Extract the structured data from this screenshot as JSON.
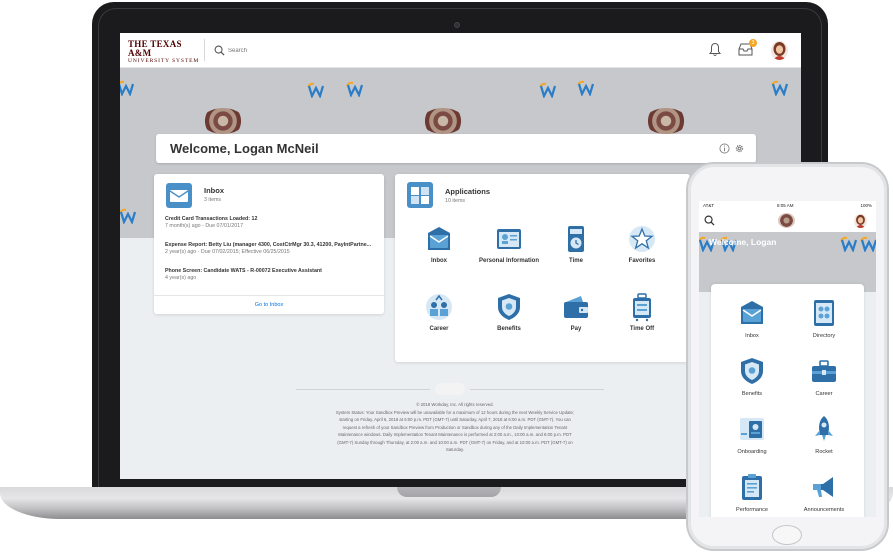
{
  "header": {
    "logo_line1": "THE TEXAS A&M",
    "logo_line2": "UNIVERSITY SYSTEM",
    "search_placeholder": "Search",
    "inbox_badge_count": "3"
  },
  "welcome": {
    "title": "Welcome, Logan McNeil"
  },
  "inbox": {
    "title": "Inbox",
    "count": "3 items",
    "items": [
      {
        "title": "Credit Card Transactions Loaded: 12",
        "sub": "7 month(s) ago - Due 07/01/2017"
      },
      {
        "title": "Expense Report: Betty Liu (manager 4300, CostCtrMgr 30.3, 41200, PayIntPartne...",
        "sub": "2 year(s) ago - Due 07/02/2015; Effective 06/25/2015"
      },
      {
        "title": "Phone Screen: Candidate WATS - R-00072 Executive Assistant",
        "sub": "4 year(s) ago"
      }
    ],
    "footer_link": "Go to Inbox"
  },
  "applications": {
    "title": "Applications",
    "count": "10 items",
    "apps": [
      {
        "label": "Inbox",
        "icon": "inbox-icon"
      },
      {
        "label": "Personal Information",
        "icon": "id-card-icon"
      },
      {
        "label": "Time",
        "icon": "clock-icon"
      },
      {
        "label": "Favorites",
        "icon": "star-icon"
      },
      {
        "label": "Career",
        "icon": "career-icon"
      },
      {
        "label": "Benefits",
        "icon": "shield-icon"
      },
      {
        "label": "Pay",
        "icon": "wallet-icon"
      },
      {
        "label": "Time Off",
        "icon": "suitcase-icon"
      }
    ]
  },
  "footer": {
    "brand": "workday",
    "lines": [
      "© 2018 Workday, Inc. All rights reserved.",
      "System Status: Your Sandbox Preview will be unavailable for a maximum of 12 hours during the next Weekly Service Update;",
      "starting on Friday, April 6, 2018 at 6:00 p.m. PDT (GMT-7) until Saturday, April 7, 2018 at 6:00 a.m. PDT (GMT-7). You can",
      "request a refresh of your Sandbox Preview from Production or Sandbox during any of the Daily Implementation Tenant",
      "Maintenance windows. Daily Implementation Tenant Maintenance is performed at 2:00 a.m., 10:00 a.m. and 6:00 p.m. PDT",
      "(GMT-7) Sunday through Thursday, at 2:00 a.m. and 10:00 a.m. PDT (GMT-7) on Friday, and at 10:00 a.m. PDT (GMT-7) on",
      "Saturday."
    ]
  },
  "phone": {
    "carrier": "AT&T",
    "time": "8:05 AM",
    "battery": "100%",
    "welcome": "Welcome, Logan",
    "apps": [
      {
        "label": "Inbox",
        "icon": "inbox-icon"
      },
      {
        "label": "Directory",
        "icon": "directory-icon"
      },
      {
        "label": "Benefits",
        "icon": "shield-icon"
      },
      {
        "label": "Career",
        "icon": "briefcase-icon"
      },
      {
        "label": "Onboarding",
        "icon": "onboarding-icon"
      },
      {
        "label": "Rocket",
        "icon": "rocket-icon"
      },
      {
        "label": "Performance",
        "icon": "clipboard-icon"
      },
      {
        "label": "Announcements",
        "icon": "megaphone-icon"
      }
    ]
  },
  "colors": {
    "brand_maroon": "#500000",
    "link_blue": "#0875e1",
    "badge_orange": "#f5a623",
    "app_icon_blue": "#4a90c8"
  }
}
